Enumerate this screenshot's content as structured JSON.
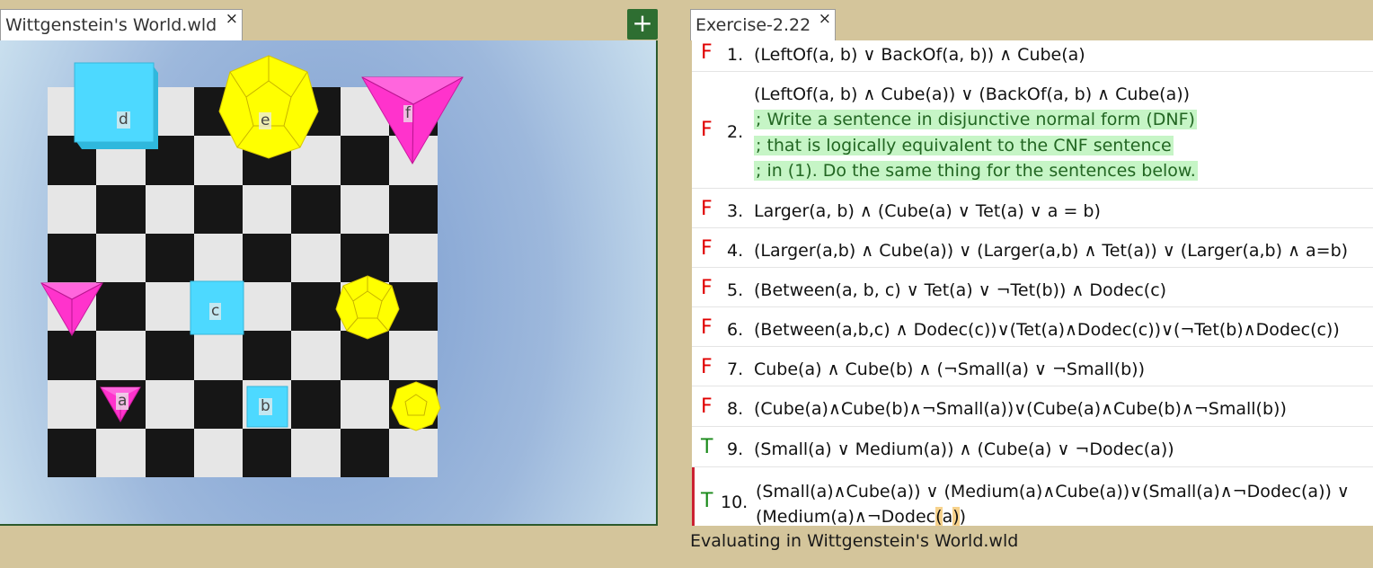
{
  "tabs": {
    "world_title": "Wittgenstein's World.wld",
    "exercise_title": "Exercise-2.22",
    "close_glyph": "×",
    "add_glyph": "+"
  },
  "colors": {
    "cube": "#4dd9ff",
    "dodec": "#ffff00",
    "tet": "#ff33cc",
    "false": "#e00000",
    "true": "#1a8a1a"
  },
  "world": {
    "objects": [
      {
        "label": "d",
        "shape": "cube",
        "size": "large"
      },
      {
        "label": "e",
        "shape": "dodec",
        "size": "large"
      },
      {
        "label": "f",
        "shape": "tet",
        "size": "large"
      },
      {
        "label": "",
        "shape": "tet",
        "size": "medium"
      },
      {
        "label": "c",
        "shape": "cube",
        "size": "medium"
      },
      {
        "label": "",
        "shape": "dodec",
        "size": "medium"
      },
      {
        "label": "a",
        "shape": "tet",
        "size": "small"
      },
      {
        "label": "b",
        "shape": "cube",
        "size": "small"
      },
      {
        "label": "",
        "shape": "dodec",
        "size": "small"
      }
    ]
  },
  "sentences": [
    {
      "tv": "F",
      "num": "1.",
      "lines": [
        "(LeftOf(a, b) ∨ BackOf(a, b)) ∧ Cube(a)"
      ]
    },
    {
      "tv": "F",
      "num": "2.",
      "lines": [
        "(LeftOf(a, b)  ∧  Cube(a)) ∨ (BackOf(a, b) ∧ Cube(a))"
      ],
      "comments": [
        "; Write a sentence in disjunctive normal form (DNF)",
        "; that is logically equivalent to the CNF sentence",
        "; in (1).  Do the same thing for the sentences below."
      ]
    },
    {
      "tv": "F",
      "num": "3.",
      "lines": [
        "Larger(a, b) ∧ (Cube(a) ∨ Tet(a) ∨ a = b)"
      ]
    },
    {
      "tv": "F",
      "num": "4.",
      "lines": [
        "(Larger(a,b)  ∧ Cube(a)) ∨ (Larger(a,b) ∧ Tet(a)) ∨ (Larger(a,b) ∧ a=b)"
      ]
    },
    {
      "tv": "F",
      "num": "5.",
      "lines": [
        "(Between(a, b, c) ∨ Tet(a) ∨ ¬Tet(b)) ∧ Dodec(c)"
      ]
    },
    {
      "tv": "F",
      "num": "6.",
      "lines": [
        "(Between(a,b,c) ∧ Dodec(c))∨(Tet(a)∧Dodec(c))∨(¬Tet(b)∧Dodec(c))"
      ]
    },
    {
      "tv": "F",
      "num": "7.",
      "lines": [
        "Cube(a) ∧ Cube(b) ∧ (¬Small(a) ∨ ¬Small(b))"
      ]
    },
    {
      "tv": "F",
      "num": "8.",
      "lines": [
        "(Cube(a)∧Cube(b)∧¬Small(a))∨(Cube(a)∧Cube(b)∧¬Small(b))"
      ]
    },
    {
      "tv": "T",
      "num": "9.",
      "lines": [
        "(Small(a) ∨ Medium(a)) ∧ (Cube(a) ∨ ¬Dodec(a))"
      ]
    },
    {
      "tv": "T",
      "num": "10.",
      "lines": [
        "(Small(a)∧Cube(a)) ∨ (Medium(a)∧Cube(a))∨(Small(a)∧¬Dodec(a)) ∨"
      ],
      "last_line": {
        "pre": "(Medium(a)∧¬Dodec",
        "hl1": "(",
        "mid": "a",
        "hl2": ")",
        "post": ")"
      }
    }
  ],
  "status": "Evaluating in Wittgenstein's World.wld"
}
